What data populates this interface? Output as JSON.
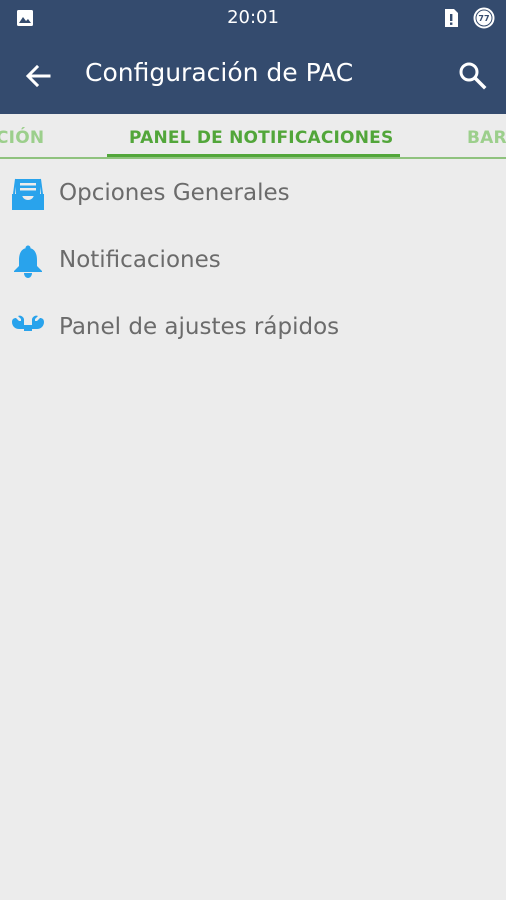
{
  "status_bar": {
    "time": "20:01",
    "left_icon": "image-icon",
    "right_icons": [
      "sim-alert-icon",
      "battery-77-icon"
    ],
    "battery_level": "77"
  },
  "app_bar": {
    "title": "Configuración de PAC",
    "back_icon": "arrow-back-icon",
    "search_icon": "search-icon",
    "background_color": "#344b6e"
  },
  "tabs": {
    "prev_partial_label": "CIÓN",
    "active_label": "PANEL DE NOTIFICACIONES",
    "next_partial_label": "BAR",
    "accent_color": "#52a63a"
  },
  "list": {
    "items": [
      {
        "label": "Opciones Generales",
        "icon": "inbox-tray-icon"
      },
      {
        "label": "Notificaciones",
        "icon": "bell-icon"
      },
      {
        "label": "Panel de ajustes rápidos",
        "icon": "wrench-icon"
      }
    ],
    "icon_color": "#29a3ec"
  }
}
